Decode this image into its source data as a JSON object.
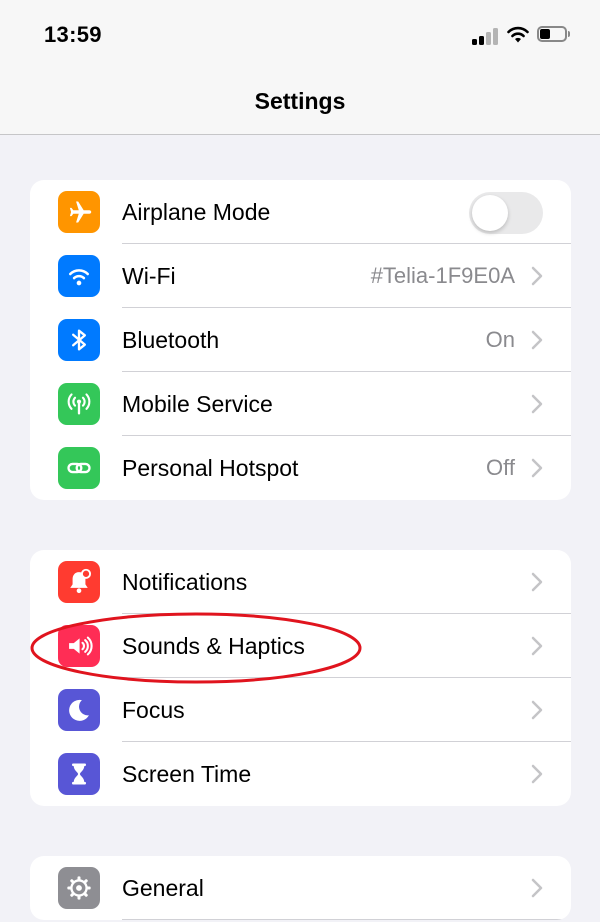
{
  "status_bar": {
    "time": "13:59"
  },
  "nav": {
    "title": "Settings"
  },
  "groups": [
    {
      "rows": [
        {
          "label": "Airplane Mode",
          "icon": "airplane-icon",
          "color": "#ff9500",
          "toggle": false
        },
        {
          "label": "Wi-Fi",
          "value": "#Telia-1F9E0A",
          "icon": "wifi-icon",
          "color": "#007aff"
        },
        {
          "label": "Bluetooth",
          "value": "On",
          "icon": "bluetooth-icon",
          "color": "#007aff"
        },
        {
          "label": "Mobile Service",
          "icon": "antenna-icon",
          "color": "#34c759"
        },
        {
          "label": "Personal Hotspot",
          "value": "Off",
          "icon": "hotspot-link-icon",
          "color": "#34c759"
        }
      ]
    },
    {
      "rows": [
        {
          "label": "Notifications",
          "icon": "bell-icon",
          "color": "#ff3b30"
        },
        {
          "label": "Sounds & Haptics",
          "icon": "speaker-icon",
          "color": "#ff2d55"
        },
        {
          "label": "Focus",
          "icon": "moon-icon",
          "color": "#5856d6"
        },
        {
          "label": "Screen Time",
          "icon": "hourglass-icon",
          "color": "#5856d6"
        }
      ]
    },
    {
      "rows": [
        {
          "label": "General",
          "icon": "gear-icon",
          "color": "#8e8e93"
        }
      ]
    }
  ],
  "annotation_color": "#e0141e"
}
